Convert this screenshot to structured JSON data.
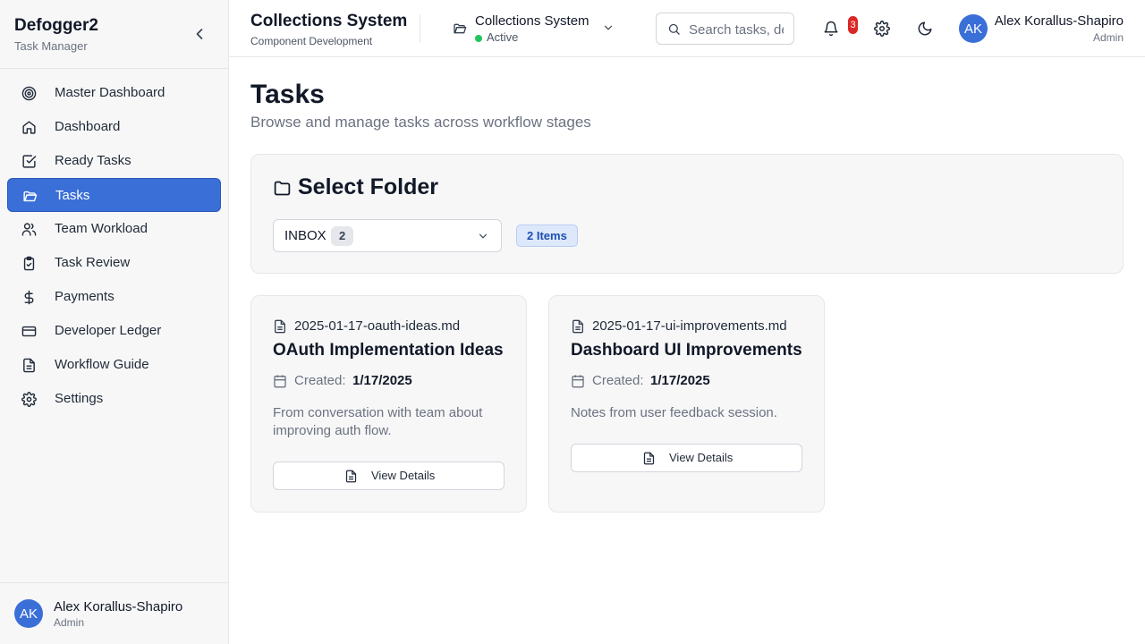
{
  "sidebar": {
    "brand_title": "Defogger2",
    "brand_subtitle": "Task Manager",
    "items": [
      {
        "label": "Master Dashboard",
        "icon": "target-icon"
      },
      {
        "label": "Dashboard",
        "icon": "home-icon"
      },
      {
        "label": "Ready Tasks",
        "icon": "check-square-icon"
      },
      {
        "label": "Tasks",
        "icon": "folder-open-icon",
        "active": true
      },
      {
        "label": "Team Workload",
        "icon": "users-icon"
      },
      {
        "label": "Task Review",
        "icon": "clipboard-check-icon"
      },
      {
        "label": "Payments",
        "icon": "dollar-icon"
      },
      {
        "label": "Developer Ledger",
        "icon": "credit-card-icon"
      },
      {
        "label": "Workflow Guide",
        "icon": "document-icon"
      },
      {
        "label": "Settings",
        "icon": "gear-icon"
      }
    ],
    "user": {
      "initials": "AK",
      "name": "Alex Korallus-Shapiro",
      "role": "Admin"
    }
  },
  "header": {
    "title": "Collections System",
    "subtitle": "Component Development",
    "project": {
      "name": "Collections System",
      "status": "Active"
    },
    "search": {
      "placeholder": "Search tasks, de"
    },
    "notifications_count": "3",
    "user": {
      "initials": "AK",
      "name": "Alex Korallus-Shapiro",
      "role": "Admin"
    }
  },
  "main": {
    "title": "Tasks",
    "subtitle": "Browse and manage tasks across workflow stages",
    "folder_panel": {
      "title": "Select Folder",
      "selected_folder": "INBOX",
      "selected_count": "2",
      "items_badge": "2 Items"
    },
    "cards": [
      {
        "filename": "2025-01-17-oauth-ideas.md",
        "title": "OAuth Implementation Ideas",
        "created_label": "Created:",
        "created_date": "1/17/2025",
        "description": "From conversation with team about improving auth flow.",
        "button_label": "View Details"
      },
      {
        "filename": "2025-01-17-ui-improvements.md",
        "title": "Dashboard UI Improvements",
        "created_label": "Created:",
        "created_date": "1/17/2025",
        "description": "Notes from user feedback session.",
        "button_label": "View Details"
      }
    ]
  },
  "colors": {
    "accent": "#3b6fd8",
    "badge_red": "#dc2626",
    "status_green": "#22c55e"
  }
}
